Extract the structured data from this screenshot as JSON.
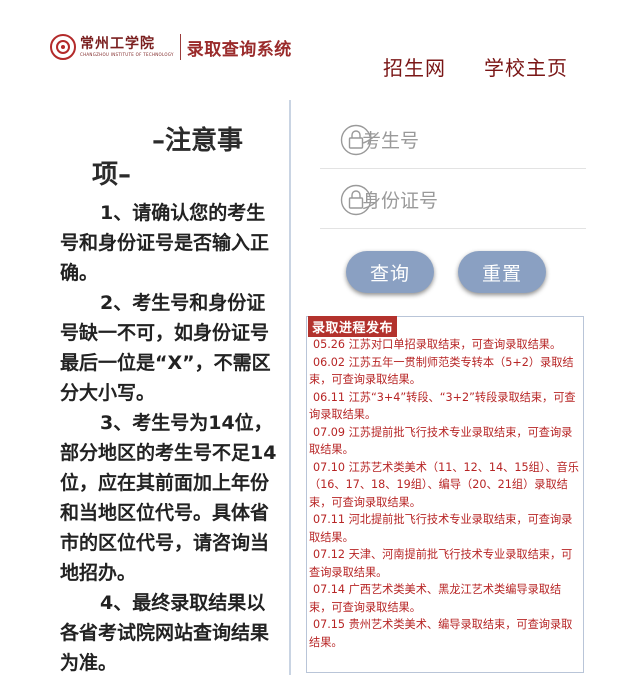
{
  "header": {
    "school_name": "常州工学院",
    "school_name_en": "CHANGZHOU INSTITUTE OF TECHNOLOGY",
    "system_name": "录取查询系统"
  },
  "nav": {
    "items": [
      "招生网",
      "学校主页"
    ]
  },
  "notice": {
    "title_line1": "–注意事",
    "title_line2": "项–",
    "paragraphs": [
      "1、请确认您的考生号和身份证号是否输入正确。",
      "2、考生号和身份证号缺一不可，如身份证号最后一位是“X”，不需区分大小写。",
      "3、考生号为14位，部分地区的考生号不足14位，应在其前面加上年份和当地区位代号。具体省市的区位代号，请咨询当地招办。",
      "4、最终录取结果以各省考试院网站查询结果为准。"
    ]
  },
  "form": {
    "exam_no_placeholder": "考生号",
    "id_no_placeholder": "身份证号",
    "query_label": "查询",
    "reset_label": "重置"
  },
  "news": {
    "heading": "录取进程发布",
    "items": [
      "05.26 江苏对口单招录取结束，可查询录取结果。",
      "06.02 江苏五年一贯制师范类专转本（5+2）录取结束，可查询录取结果。",
      "06.11 江苏“3+4”转段、“3+2”转段录取结束，可查询录取结果。",
      "07.09 江苏提前批飞行技术专业录取结束，可查询录取结果。",
      "07.10 江苏艺术类美术（11、12、14、15组）、音乐（16、17、18、19组）、编导（20、21组）录取结束，可查询录取结果。",
      "07.11 河北提前批飞行技术专业录取结束，可查询录取结果。",
      "07.12 天津、河南提前批飞行技术专业录取结束，可查询录取结果。",
      "07.14 广西艺术类美术、黑龙江艺术类编导录取结束，可查询录取结果。",
      "07.15 贵州艺术类美术、编导录取结束，可查询录取结果。"
    ]
  },
  "colors": {
    "brand": "#7a1616",
    "news_red": "#b72525",
    "button": "#8aa0c2",
    "divider": "#c9d4e3"
  }
}
